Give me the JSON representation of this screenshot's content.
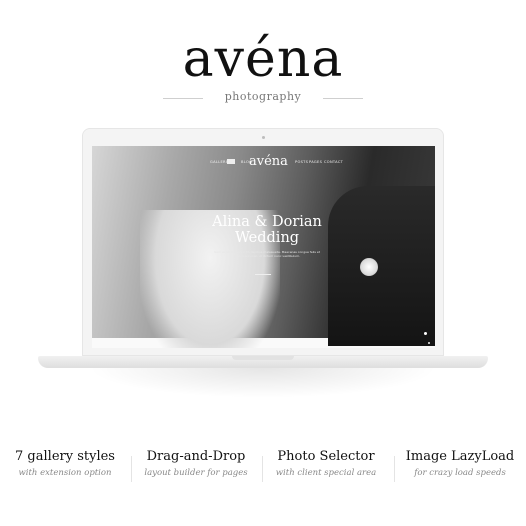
{
  "brand": {
    "logo": "avéna",
    "subtitle": "photography"
  },
  "preview": {
    "nav": {
      "items": [
        "GALLERIES",
        "BLOG",
        "POSTS",
        "PAGES",
        "CONTACT"
      ],
      "logo": "avéna"
    },
    "hero": {
      "title": "Alina & Dorian Wedding",
      "text": "Nam ac tortor quis nibh dapibus malesuada. Maecenas congue felis et massa pulvinar, ut dictum nunc vestibulum."
    }
  },
  "features": [
    {
      "title": "7 gallery styles",
      "subtitle": "with extension option"
    },
    {
      "title": "Drag-and-Drop",
      "subtitle": "layout builder for pages"
    },
    {
      "title": "Photo Selector",
      "subtitle": "with client special area"
    },
    {
      "title": "Image LazyLoad",
      "subtitle": "for crazy load speeds"
    }
  ]
}
